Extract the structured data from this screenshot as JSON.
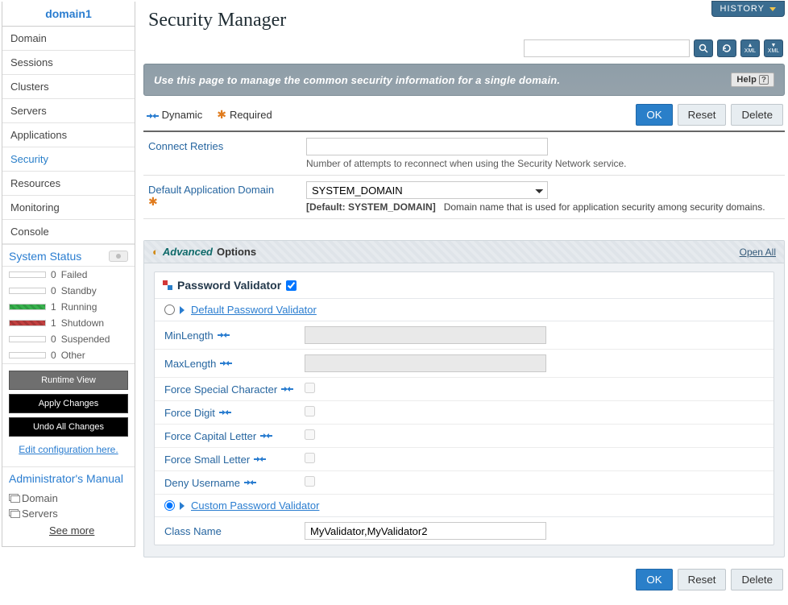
{
  "sidebar": {
    "title": "domain1",
    "nav": [
      {
        "label": "Domain"
      },
      {
        "label": "Sessions"
      },
      {
        "label": "Clusters"
      },
      {
        "label": "Servers"
      },
      {
        "label": "Applications"
      },
      {
        "label": "Security"
      },
      {
        "label": "Resources"
      },
      {
        "label": "Monitoring"
      },
      {
        "label": "Console"
      }
    ],
    "status_header": "System Status",
    "statuses": [
      {
        "count": "0",
        "label": "Failed",
        "fill": ""
      },
      {
        "count": "0",
        "label": "Standby",
        "fill": ""
      },
      {
        "count": "1",
        "label": "Running",
        "fill": "green"
      },
      {
        "count": "1",
        "label": "Shutdown",
        "fill": "red"
      },
      {
        "count": "0",
        "label": "Suspended",
        "fill": ""
      },
      {
        "count": "0",
        "label": "Other",
        "fill": ""
      }
    ],
    "buttons": {
      "runtime": "Runtime View",
      "apply": "Apply Changes",
      "undo": "Undo All Changes"
    },
    "edit_link": "Edit configuration here.",
    "manual": {
      "title": "Administrator's Manual",
      "items": [
        "Domain",
        "Servers"
      ],
      "see_more": "See more"
    }
  },
  "header": {
    "history": "HISTORY",
    "page_title": "Security Manager",
    "search_placeholder": "",
    "icons": [
      "search-icon",
      "refresh-icon",
      "xml-export-icon",
      "xml-import-icon"
    ]
  },
  "banner": {
    "text": "Use this page to manage the common security information for a single domain.",
    "help": "Help"
  },
  "legend": {
    "dynamic": "Dynamic",
    "required": "Required"
  },
  "buttons": {
    "ok": "OK",
    "reset": "Reset",
    "delete": "Delete"
  },
  "form": {
    "connect_retries": {
      "label": "Connect Retries",
      "value": "",
      "hint": "Number of attempts to reconnect when using the Security Network service."
    },
    "app_domain": {
      "label": "Default Application Domain",
      "value": "SYSTEM_DOMAIN",
      "default_prefix": "[Default: ",
      "default_value": "SYSTEM_DOMAIN",
      "default_suffix": "]",
      "hint": "Domain name that is used for application security among security domains."
    }
  },
  "advanced": {
    "marker": "⬤",
    "title_em": "Advanced",
    "title_rest": " Options",
    "open_all": "Open All",
    "panel_title": "Password Validator",
    "default_validator": {
      "title": "Default Password Validator",
      "rows": [
        {
          "label": "MinLength",
          "dyn": true,
          "type": "text"
        },
        {
          "label": "MaxLength",
          "dyn": true,
          "type": "text"
        },
        {
          "label": "Force Special Character",
          "dyn": true,
          "type": "check"
        },
        {
          "label": "Force Digit",
          "dyn": true,
          "type": "check"
        },
        {
          "label": "Force Capital Letter",
          "dyn": true,
          "type": "check"
        },
        {
          "label": "Force Small Letter",
          "dyn": true,
          "type": "check"
        },
        {
          "label": "Deny Username",
          "dyn": true,
          "type": "check"
        }
      ]
    },
    "custom_validator": {
      "title": "Custom Password Validator",
      "class_name_label": "Class Name",
      "class_name_value": "MyValidator,MyValidator2"
    }
  }
}
